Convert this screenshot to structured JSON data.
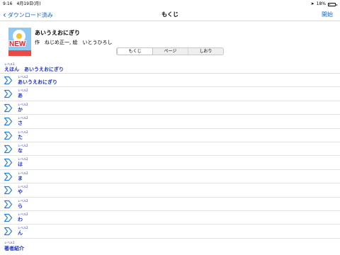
{
  "status_bar": {
    "time": "9:16",
    "date": "4月19日(月)",
    "battery": "18%",
    "battery_level": 0.18
  },
  "nav": {
    "back_label": "ダウンロード済み",
    "title": "もくじ",
    "start_label": "開始"
  },
  "book": {
    "cover_badge": "NEW",
    "title": "あいうえおにぎり",
    "credits": "作　ねじめ正一, 絵　いとうひろし"
  },
  "segments": {
    "items": [
      "もくじ",
      "ページ",
      "しおり"
    ],
    "selected": "もくじ"
  },
  "toc_top": {
    "level": "レベル1",
    "title": "えほん　あいうえおにぎり"
  },
  "toc_items": [
    {
      "level": "レベル2",
      "title": "あいうえおにぎり"
    },
    {
      "level": "レベル2",
      "title": "あ"
    },
    {
      "level": "レベル2",
      "title": "か"
    },
    {
      "level": "レベル2",
      "title": "さ"
    },
    {
      "level": "レベル2",
      "title": "た"
    },
    {
      "level": "レベル2",
      "title": "な"
    },
    {
      "level": "レベル2",
      "title": "は"
    },
    {
      "level": "レベル2",
      "title": "ま"
    },
    {
      "level": "レベル2",
      "title": "や"
    },
    {
      "level": "レベル2",
      "title": "ら"
    },
    {
      "level": "レベル2",
      "title": "わ"
    },
    {
      "level": "レベル2",
      "title": "ん"
    }
  ],
  "toc_bottom": {
    "level": "レベル1",
    "title": "著者紹介"
  },
  "colors": {
    "accent": "#0a64d8",
    "toc_text": "#1a2fd0",
    "arrow": "#2a7fd6"
  },
  "icons": {
    "back": "chevron-left-icon",
    "row": "chevron-right-icon",
    "location": "location-arrow-icon",
    "battery": "battery-icon"
  }
}
